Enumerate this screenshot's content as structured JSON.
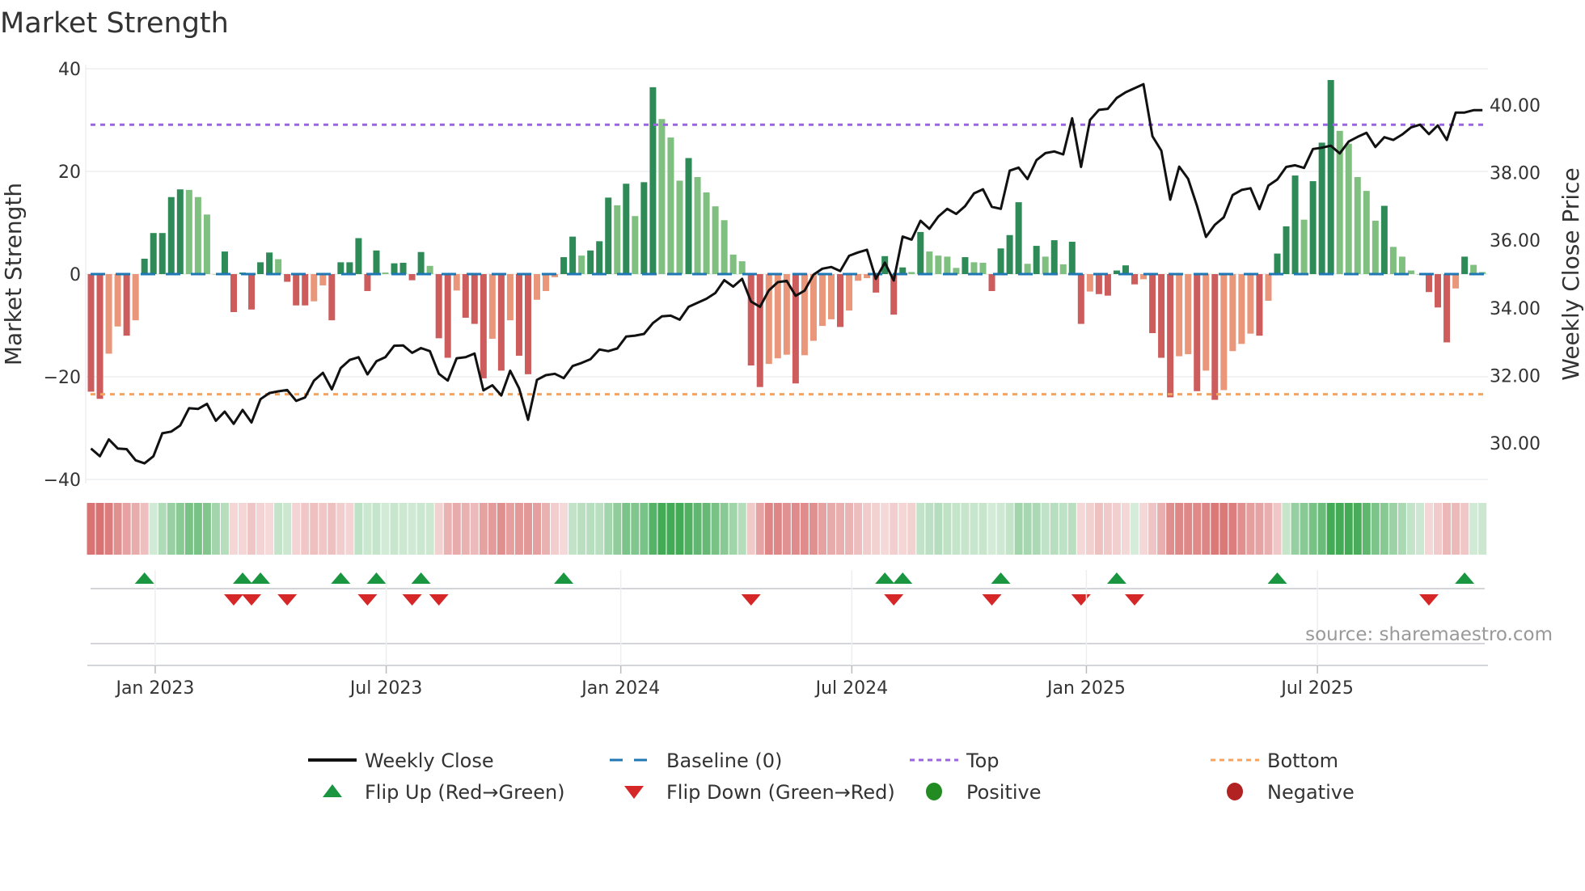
{
  "chart_data": {
    "type": "bar",
    "title": "Market Strength",
    "ylabel": "Market Strength",
    "y2label": "Weekly Close Price",
    "ylim": [
      -40,
      40
    ],
    "y2lim": [
      28.92,
      41.08
    ],
    "yticks": [
      "40",
      "20",
      "0",
      "−20",
      "−40"
    ],
    "yticks_values": [
      40,
      20,
      0,
      -20,
      -40
    ],
    "y2ticks": [
      "30.00",
      "32.00",
      "34.00",
      "36.00",
      "38.00",
      "40.00"
    ],
    "y2ticks_values": [
      30,
      32,
      34,
      36,
      38,
      40
    ],
    "xticks": [
      "Jan 2023",
      "Jul 2023",
      "Jan 2024",
      "Jul 2024",
      "Jan 2025",
      "Jul 2025"
    ],
    "xticks_week_index": [
      7.2,
      33.1,
      59.4,
      85.3,
      111.6,
      137.5
    ],
    "top_level": 29.1,
    "bottom_level": -23.4,
    "baseline": 0,
    "grid": true,
    "legend_position": "bottom",
    "strength": [
      -22.9,
      -24.3,
      -15.5,
      -10.2,
      -12,
      -9,
      3,
      8,
      8,
      15,
      16.5,
      16.4,
      15,
      11.6,
      0,
      4.4,
      -7.4,
      0.3,
      -6.9,
      2.3,
      4.2,
      2.9,
      -1.5,
      -6.1,
      -6.1,
      -5.3,
      -2.2,
      -9,
      2.3,
      2.3,
      7,
      -3.3,
      4.6,
      0.3,
      2.1,
      2.2,
      -1.2,
      4.3,
      1.6,
      -12.5,
      -16.3,
      -3.2,
      -8.5,
      -9.7,
      -20.3,
      -12.6,
      -18.8,
      -9,
      -15.9,
      -19.5,
      -5,
      -3.3,
      -0.6,
      3.3,
      7.3,
      3.6,
      4.6,
      6.4,
      14.9,
      13.4,
      17.6,
      11.3,
      17.9,
      36.4,
      30.2,
      26.6,
      18.2,
      22.6,
      18.9,
      15.9,
      13.2,
      10.5,
      3.8,
      2.5,
      -17.8,
      -22,
      -17.5,
      -16.4,
      -15.7,
      -21.3,
      -15.8,
      -13,
      -10.1,
      -8.8,
      -10.3,
      -7.1,
      -1.3,
      -0.8,
      -3.6,
      3.5,
      -7.9,
      1.3,
      0.4,
      8.2,
      4.4,
      3.6,
      3.4,
      1.2,
      3.3,
      2.3,
      2.2,
      -3.3,
      5,
      7.6,
      14,
      2,
      5.5,
      3.4,
      6.6,
      1.9,
      6.3,
      -9.7,
      -3.4,
      -3.9,
      -4.2,
      0.7,
      1.7,
      -2,
      -1,
      -11.5,
      -16.3,
      -24,
      -16,
      -15.6,
      -22.8,
      -18.8,
      -24.5,
      -22.6,
      -15,
      -13.6,
      -11.6,
      -12,
      -5.2,
      4,
      9.3,
      19.2,
      10.6,
      18.1,
      25.6,
      37.8,
      27.9,
      25.4,
      18.9,
      16.2,
      10.4,
      13.3,
      5.3,
      3.4,
      0.7,
      0,
      -3.5,
      -6.5,
      -13.3,
      -2.8,
      3.4,
      1.8,
      0.4
    ],
    "weekly_close": [
      29.84,
      29.61,
      30.11,
      29.84,
      29.82,
      29.49,
      29.4,
      29.61,
      30.29,
      30.34,
      30.52,
      31.03,
      31.01,
      31.16,
      30.66,
      30.93,
      30.57,
      30.98,
      30.61,
      31.3,
      31.48,
      31.53,
      31.57,
      31.25,
      31.35,
      31.85,
      32.08,
      31.59,
      32.22,
      32.46,
      32.54,
      32.03,
      32.42,
      32.54,
      32.88,
      32.89,
      32.67,
      32.81,
      32.72,
      32.05,
      31.85,
      32.51,
      32.54,
      32.65,
      31.56,
      31.71,
      31.41,
      32.14,
      31.62,
      30.69,
      31.87,
      32.01,
      32.05,
      31.92,
      32.28,
      32.37,
      32.48,
      32.77,
      32.72,
      32.8,
      33.15,
      33.18,
      33.23,
      33.55,
      33.75,
      33.77,
      33.65,
      34.03,
      34.15,
      34.27,
      34.44,
      34.82,
      34.63,
      34.86,
      34.19,
      34.03,
      34.52,
      34.76,
      34.8,
      34.36,
      34.51,
      34.98,
      35.16,
      35.21,
      35.09,
      35.54,
      35.64,
      35.72,
      34.86,
      35.34,
      34.81,
      36.11,
      36.02,
      36.58,
      36.34,
      36.7,
      36.93,
      36.78,
      37.01,
      37.39,
      37.51,
      36.99,
      36.93,
      38.06,
      38.15,
      37.81,
      38.37,
      38.58,
      38.63,
      38.54,
      39.61,
      38.17,
      39.56,
      39.86,
      39.89,
      40.21,
      40.38,
      40.5,
      40.62,
      39.08,
      38.65,
      37.2,
      38.18,
      37.82,
      37.02,
      36.1,
      36.46,
      36.68,
      37.34,
      37.49,
      37.54,
      36.92,
      37.62,
      37.8,
      38.17,
      38.22,
      38.14,
      38.7,
      38.74,
      38.8,
      38.57,
      38.92,
      39.06,
      39.18,
      38.76,
      39.05,
      38.97,
      39.13,
      39.34,
      39.42,
      39.14,
      39.4,
      38.97,
      39.78,
      39.78,
      39.85,
      39.85
    ],
    "flip_up_week_index": [
      6,
      17,
      19,
      28,
      32,
      37,
      53,
      89,
      91,
      102,
      115,
      133,
      154
    ],
    "flip_down_week_index": [
      16,
      18,
      22,
      31,
      36,
      39,
      74,
      90,
      101,
      111,
      117,
      150
    ],
    "colors": {
      "positive_rising": "#2e8b57",
      "positive_falling": "#7fbf7f",
      "negative_falling": "#cd5c5c",
      "negative_rising": "#e9967a",
      "close": "#111111",
      "baseline": "#1f77b4",
      "top": "#9966dd",
      "bottom": "#f4a460",
      "flip_up": "#1a9641",
      "flip_down": "#d62728"
    }
  },
  "source": "source: sharemaestro.com",
  "legend": [
    {
      "label": "Weekly Close",
      "kind": "line"
    },
    {
      "label": "Baseline (0)",
      "kind": "dash"
    },
    {
      "label": "Top",
      "kind": "dot-purple"
    },
    {
      "label": "Bottom",
      "kind": "dot-orange"
    },
    {
      "label": "Flip Up (Red→Green)",
      "kind": "tri-up"
    },
    {
      "label": "Flip Down (Green→Red)",
      "kind": "tri-down"
    },
    {
      "label": "Positive",
      "kind": "dot-green"
    },
    {
      "label": "Negative",
      "kind": "dot-red"
    }
  ]
}
